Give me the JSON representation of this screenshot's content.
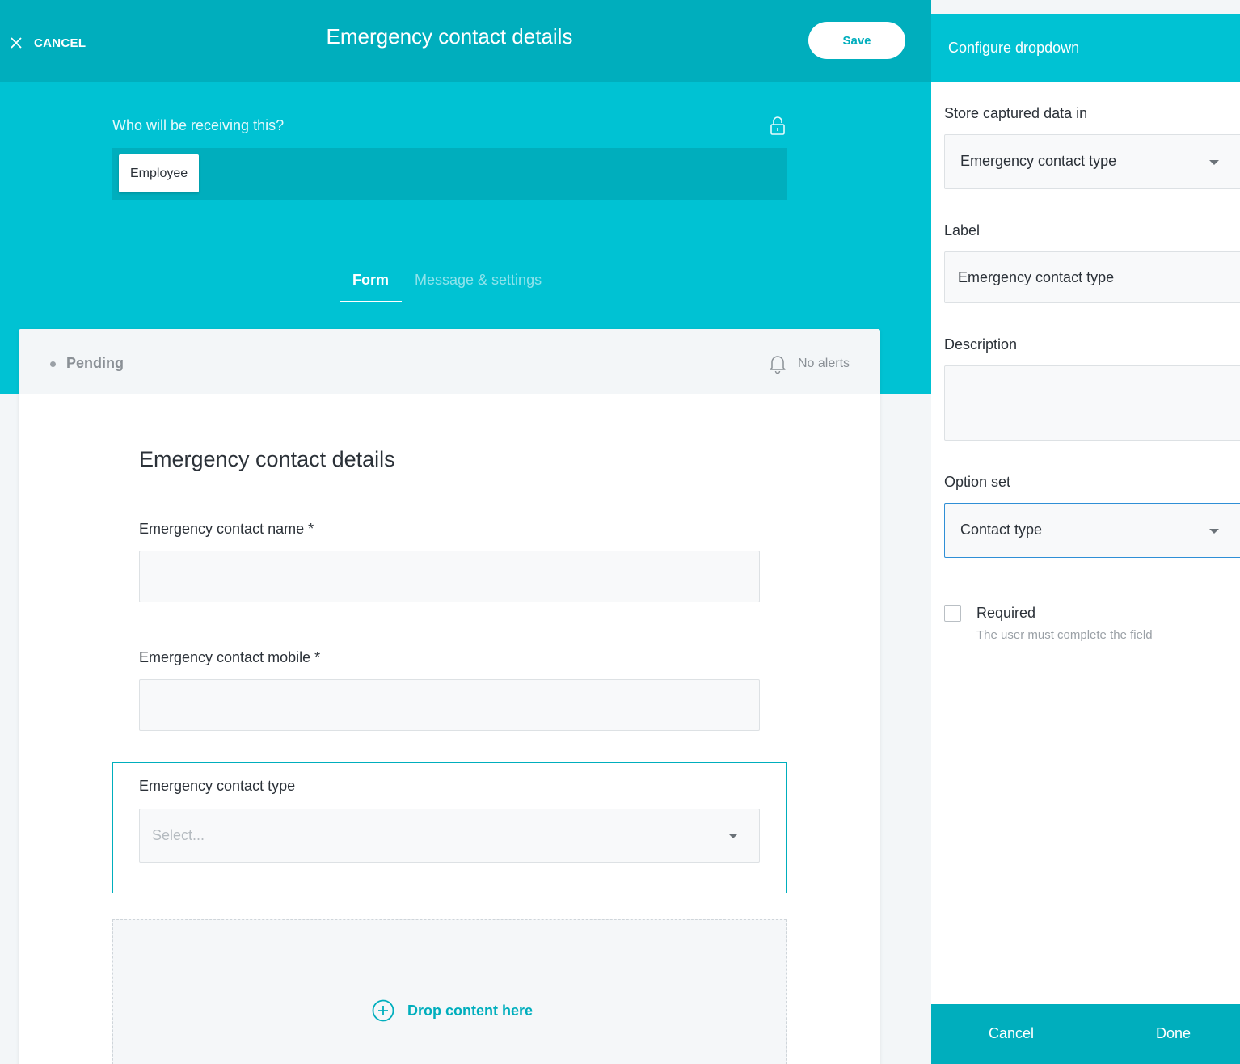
{
  "header": {
    "cancel_label": "CANCEL",
    "title": "Emergency contact details",
    "save_label": "Save"
  },
  "recipients": {
    "label": "Who will be receiving this?",
    "chip": "Employee"
  },
  "tabs": [
    {
      "label": "Form",
      "active": true
    },
    {
      "label": "Message & settings",
      "active": false
    }
  ],
  "card": {
    "status": "Pending",
    "alerts": "No alerts",
    "form_title": "Emergency contact details",
    "fields": {
      "name_label": "Emergency contact name *",
      "mobile_label": "Emergency contact mobile *",
      "type_label": "Emergency contact type",
      "type_placeholder": "Select..."
    },
    "drop_label": "Drop content here"
  },
  "panel": {
    "title": "Configure dropdown",
    "store_label": "Store captured data in",
    "store_value": "Emergency contact type",
    "label_label": "Label",
    "label_value": "Emergency contact type",
    "description_label": "Description",
    "description_value": "",
    "option_set_label": "Option set",
    "option_set_value": "Contact type",
    "required_label": "Required",
    "required_help": "The user must complete the field",
    "required_checked": false,
    "cancel_label": "Cancel",
    "done_label": "Done"
  },
  "colors": {
    "teal": "#00c2d3",
    "teal_dark": "#00aebd",
    "focus_blue": "#2f8fd6"
  }
}
